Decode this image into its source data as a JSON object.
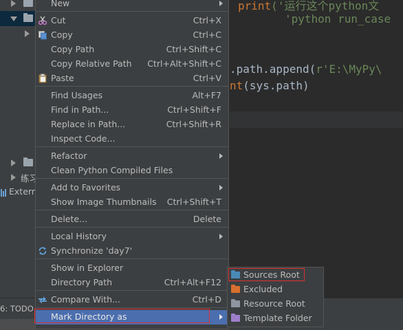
{
  "project_tree": {
    "visible_label": "练习",
    "external_label": "Extern"
  },
  "editor": {
    "line1_kw": "print",
    "line1_rest": "('运行这个python文",
    "line2_str": "'python run_case",
    "line3_plain": ".path.append(",
    "line3_str": "r'E:\\MyPy\\",
    "line4_kw": "nt",
    "line4_plain": "(sys.path)"
  },
  "bottom_bar": {
    "todo_label": "6: TODO"
  },
  "context_menu": {
    "new_label": "New",
    "cut_label": "Cut",
    "cut_shortcut": "Ctrl+X",
    "copy_label": "Copy",
    "copy_shortcut": "Ctrl+C",
    "copy_path_label": "Copy Path",
    "copy_path_shortcut": "Ctrl+Shift+C",
    "copy_relative_path_label": "Copy Relative Path",
    "copy_relative_path_shortcut": "Ctrl+Alt+Shift+C",
    "paste_label": "Paste",
    "paste_shortcut": "Ctrl+V",
    "find_usages_label": "Find Usages",
    "find_usages_shortcut": "Alt+F7",
    "find_in_path_label": "Find in Path...",
    "find_in_path_shortcut": "Ctrl+Shift+F",
    "replace_in_path_label": "Replace in Path...",
    "replace_in_path_shortcut": "Ctrl+Shift+R",
    "inspect_code_label": "Inspect Code...",
    "refactor_label": "Refactor",
    "clean_compiled_label": "Clean Python Compiled Files",
    "add_to_favorites_label": "Add to Favorites",
    "show_thumbnails_label": "Show Image Thumbnails",
    "show_thumbnails_shortcut": "Ctrl+Shift+T",
    "delete_label": "Delete...",
    "delete_shortcut": "Delete",
    "local_history_label": "Local History",
    "synchronize_label": "Synchronize 'day7'",
    "show_in_explorer_label": "Show in Explorer",
    "directory_path_label": "Directory Path",
    "directory_path_shortcut": "Ctrl+Alt+F12",
    "compare_with_label": "Compare With...",
    "compare_with_shortcut": "Ctrl+D",
    "mark_directory_as_label": "Mark Directory as"
  },
  "submenu": {
    "sources_root_label": "Sources Root",
    "excluded_label": "Excluded",
    "resource_root_label": "Resource Root",
    "template_folder_label": "Template Folder"
  },
  "colors": {
    "menu_bg": "#3c3f41",
    "highlight": "#4b6eaf",
    "annotation_red": "#e03030",
    "sources_folder": "#4a8ab5",
    "excluded_folder": "#d7702e",
    "resource_folder": "#8f96a1",
    "template_folder": "#9c7fc8"
  }
}
